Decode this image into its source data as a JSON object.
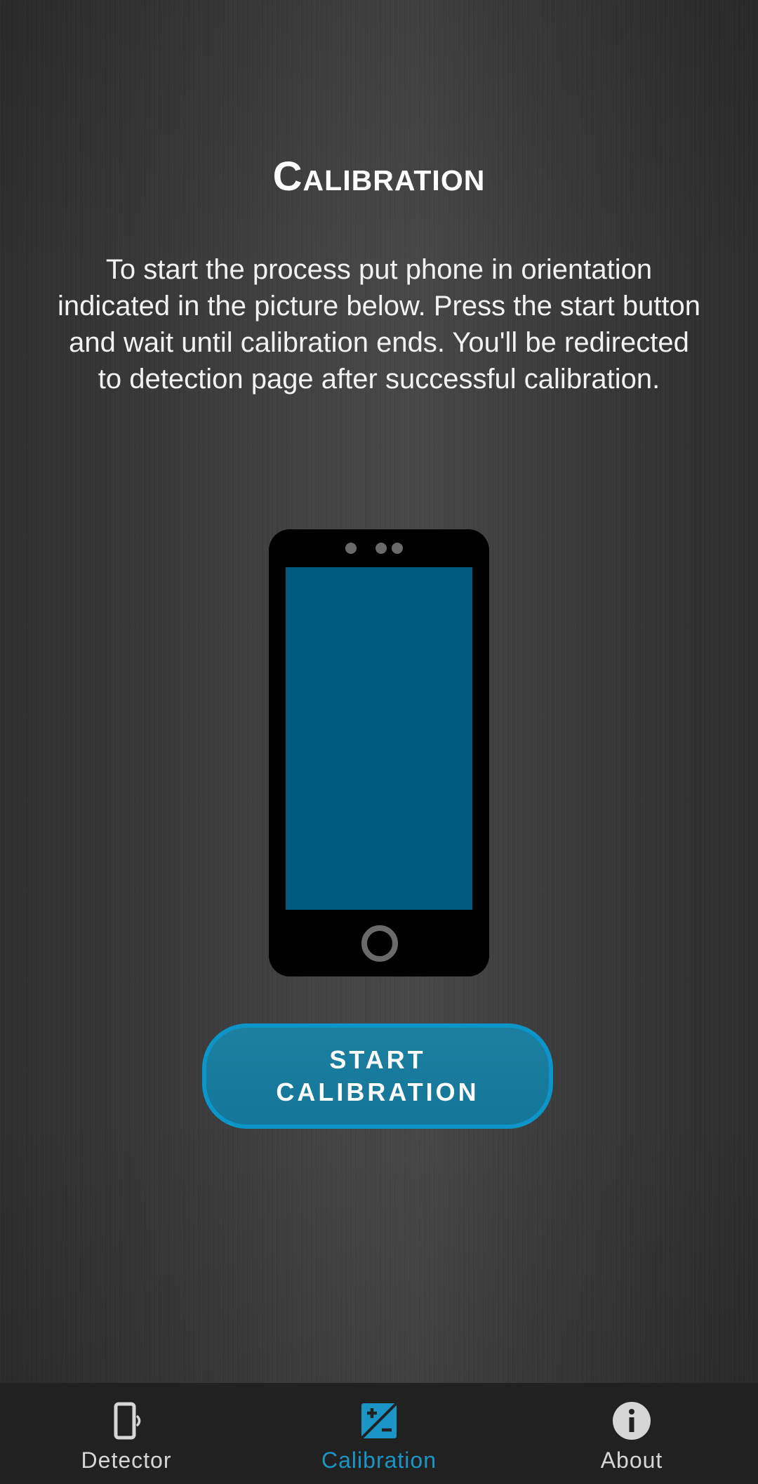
{
  "page": {
    "title": "Calibration",
    "description": "To start the process put phone in orientation indicated in the picture below. Press the start button and wait until calibration ends. You'll be redirected to detection page after successful calibration."
  },
  "illustration": {
    "icon": "phone-portrait-illustration",
    "screen_color": "#015b80"
  },
  "start_button": {
    "label": "START CALIBRATION",
    "border_color": "#0b95c8"
  },
  "bottom_nav": {
    "active": "Calibration",
    "active_color": "#1a95c6",
    "items": [
      {
        "label": "Detector",
        "icon": "phone-vibrate-icon"
      },
      {
        "label": "Calibration",
        "icon": "exposure-plus-minus-icon"
      },
      {
        "label": "About",
        "icon": "info-icon"
      }
    ]
  }
}
